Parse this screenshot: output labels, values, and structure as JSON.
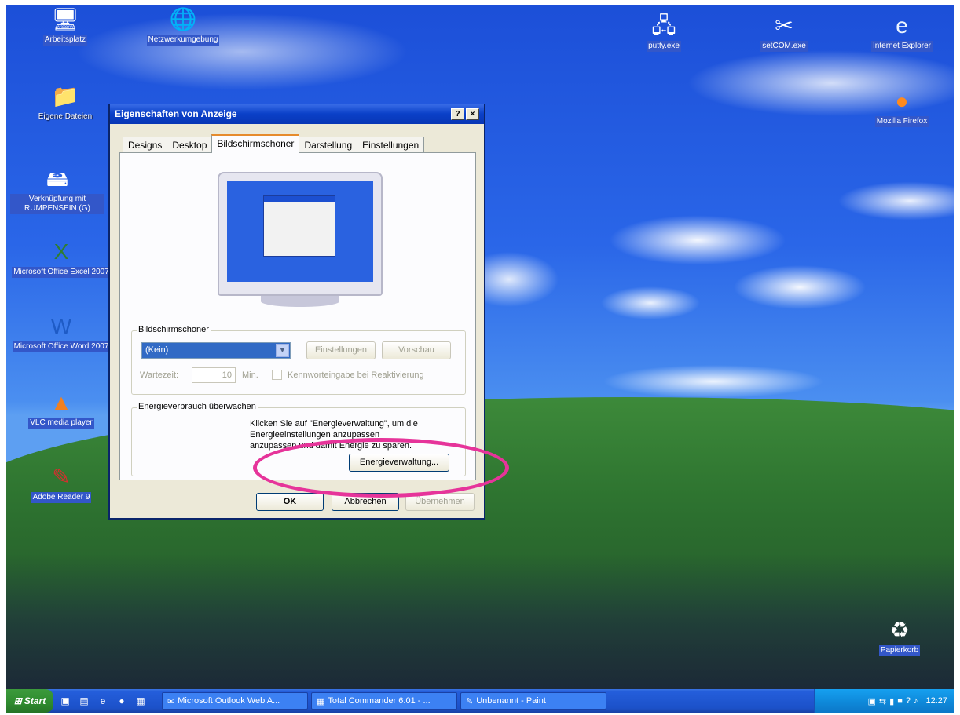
{
  "desktop": {
    "icons": [
      {
        "label": "Arbeitsplatz",
        "icon": "computer-icon"
      },
      {
        "label": "Netzwerkumgebung",
        "icon": "network-icon"
      },
      {
        "label": "Eigene Dateien",
        "icon": "documents-folder-icon"
      },
      {
        "label": "Verknüpfung mit RUMPENSEIN (G)",
        "icon": "network-drive-icon"
      },
      {
        "label": "Microsoft Office Excel 2007",
        "icon": "excel-icon"
      },
      {
        "label": "Microsoft Office Word 2007",
        "icon": "word-icon"
      },
      {
        "label": "VLC media player",
        "icon": "vlc-icon"
      },
      {
        "label": "Adobe Reader 9",
        "icon": "adobe-reader-icon"
      },
      {
        "label": "putty.exe",
        "icon": "putty-icon"
      },
      {
        "label": "setCOM.exe",
        "icon": "tools-icon"
      },
      {
        "label": "Internet Explorer",
        "icon": "internet-explorer-icon"
      },
      {
        "label": "Mozilla Firefox",
        "icon": "firefox-icon"
      },
      {
        "label": "Papierkorb",
        "icon": "recycle-bin-icon"
      }
    ]
  },
  "dialog": {
    "title": "Eigenschaften von Anzeige",
    "help_btn": "?",
    "close_btn": "×",
    "tabs": [
      "Designs",
      "Desktop",
      "Bildschirmschoner",
      "Darstellung",
      "Einstellungen"
    ],
    "active_tab": "Bildschirmschoner",
    "screensaver": {
      "legend": "Bildschirmschoner",
      "selected": "(Kein)",
      "settings_btn": "Einstellungen",
      "preview_btn": "Vorschau",
      "wait_label": "Wartezeit:",
      "wait_value": "10",
      "minutes": "Min.",
      "password_label": "Kennworteingabe bei Reaktivierung"
    },
    "energy": {
      "legend": "Energieverbrauch überwachen",
      "line1": "Klicken Sie auf \"Energieverwaltung\", um die",
      "line2": "Energieeinstellungen anzupassen",
      "line3": "anzupassen und damit Energie zu sparen.",
      "button": "Energieverwaltung..."
    },
    "ok": "OK",
    "cancel": "Abbrechen",
    "apply": "Übernehmen"
  },
  "taskbar": {
    "start": "Start",
    "items": [
      {
        "label": "Microsoft Outlook Web A...",
        "icon": "outlook-icon"
      },
      {
        "label": "Total Commander 6.01 - ...",
        "icon": "total-commander-icon"
      },
      {
        "label": "Unbenannt - Paint",
        "icon": "paint-icon"
      }
    ],
    "clock": "12:27"
  }
}
